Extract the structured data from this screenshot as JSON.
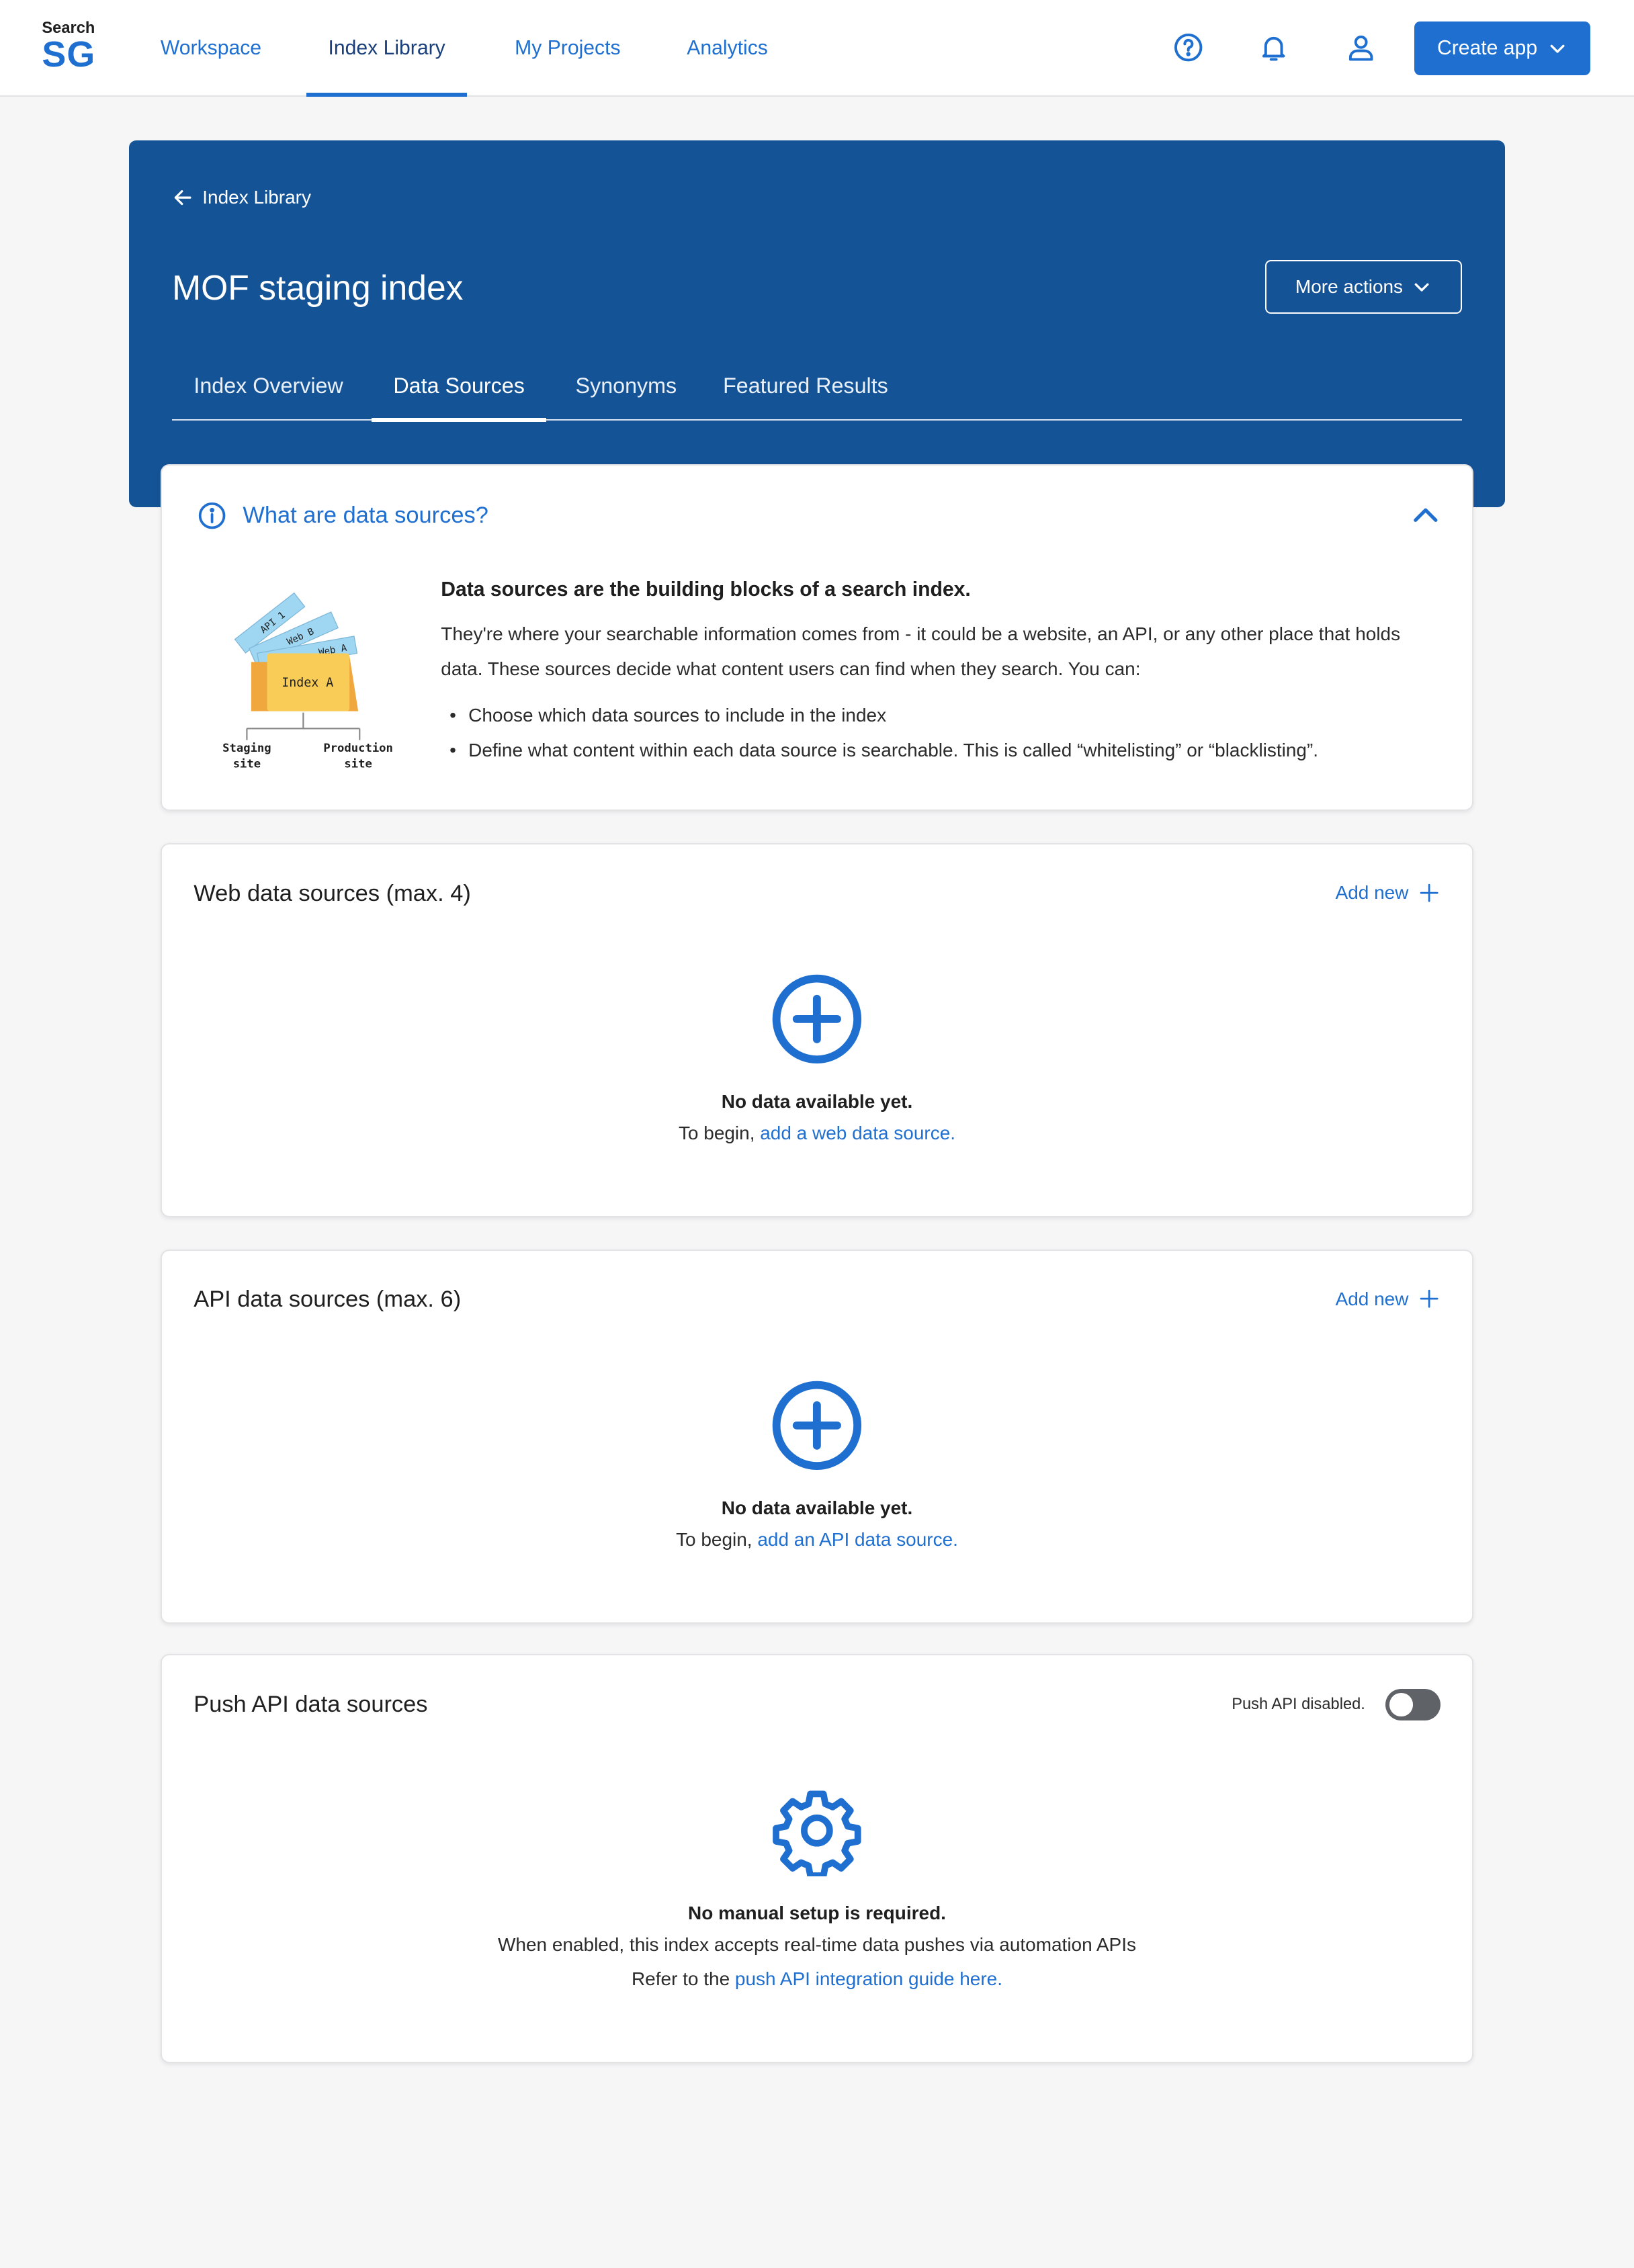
{
  "brand": {
    "small": "Search",
    "big": "SG"
  },
  "nav": [
    {
      "label": "Workspace",
      "active": false
    },
    {
      "label": "Index Library",
      "active": true
    },
    {
      "label": "My Projects",
      "active": false
    },
    {
      "label": "Analytics",
      "active": false
    }
  ],
  "header": {
    "create_label": "Create app",
    "icons": [
      "help-icon",
      "bell-icon",
      "user-icon"
    ]
  },
  "hero": {
    "back_label": "Index Library",
    "title": "MOF staging index",
    "more_actions_label": "More actions",
    "tabs": [
      {
        "label": "Index Overview",
        "active": false
      },
      {
        "label": "Data Sources",
        "active": true
      },
      {
        "label": "Synonyms",
        "active": false
      },
      {
        "label": "Featured Results",
        "active": false
      }
    ]
  },
  "info": {
    "title": "What are data sources?",
    "heading": "Data sources are the building blocks of a search index.",
    "paragraph": "They're where your searchable information comes from - it could be a website, an API, or any other place that holds data. These sources decide what content users can find when they search. You can:",
    "bullets": [
      "Choose which data sources to include in the index",
      "Define what content within each data source is searchable. This is called “whitelisting” or “blacklisting”."
    ],
    "illustration": {
      "folder_label": "Index A",
      "tags": [
        "API 1",
        "Web B",
        "Web A"
      ],
      "left_label_1": "Staging",
      "left_label_2": "site",
      "right_label_1": "Production",
      "right_label_2": "site"
    }
  },
  "web": {
    "title": "Web data sources (max. 4)",
    "add_label": "Add new",
    "empty_title": "No data available yet.",
    "empty_prefix": "To begin, ",
    "empty_link": "add a web data source."
  },
  "api": {
    "title": "API data sources (max. 6)",
    "add_label": "Add new",
    "empty_title": "No data available yet.",
    "empty_prefix": "To begin, ",
    "empty_link": "add an API data source."
  },
  "push": {
    "title": "Push API data sources",
    "toggle_label": "Push API disabled.",
    "toggle_on": false,
    "empty_title": "No manual setup is required.",
    "line1": "When enabled, this index accepts real-time data pushes via automation APIs",
    "line2_prefix": "Refer to the ",
    "line2_link": "push API integration guide here."
  },
  "colors": {
    "primary": "#1f6fd1",
    "hero_bg": "#155397",
    "page_bg": "#f6f6f7",
    "folder": "#f9cc57",
    "tag": "#9fd6f2"
  }
}
